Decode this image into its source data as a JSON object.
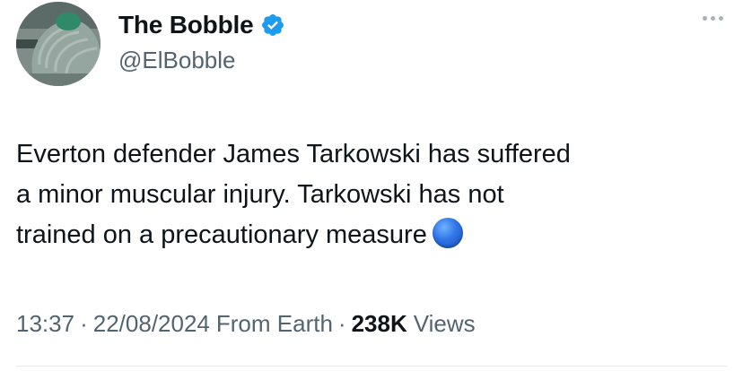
{
  "author": {
    "display_name": "The Bobble",
    "handle": "@ElBobble",
    "verified": true,
    "verified_color": "#1d9bf0"
  },
  "tweet": {
    "text": "Everton defender James Tarkowski has suffered\na minor muscular injury. Tarkowski has not\ntrained on a precautionary measure",
    "emoji_icon": "blue-circle-emoji"
  },
  "meta": {
    "time": "13:37",
    "separator": "·",
    "date": "22/08/2024",
    "source": "From Earth",
    "views_count": "238K",
    "views_label": "Views"
  },
  "colors": {
    "text_primary": "#0f1419",
    "text_secondary": "#536471",
    "accent": "#1d9bf0"
  }
}
